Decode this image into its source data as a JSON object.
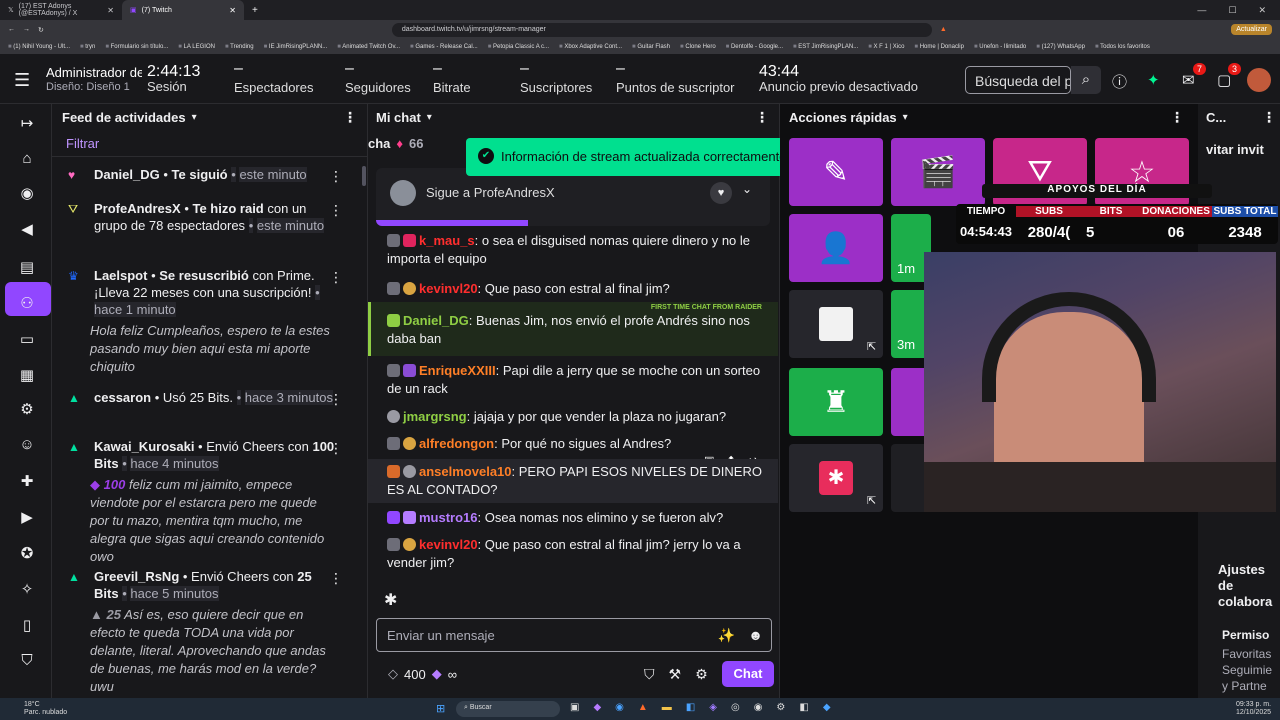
{
  "browser": {
    "tabs": [
      {
        "label": "(17) EST Adonys (@ESTAdonys) / X"
      },
      {
        "label": "(7) Twitch"
      }
    ],
    "url": "dashboard.twitch.tv/u/jimrsng/stream-manager",
    "update_label": "Actualizar",
    "bookmarks": [
      "(1) Nihil Young - Ult...",
      "tryn",
      "Formulario sin título...",
      "LA LEGION",
      "Trending",
      "IE JimRisingPLANN...",
      "Animated Twitch Ov...",
      "Games - Release Cal...",
      "Petopia Classic A c...",
      "Xbox Adaptive Cont...",
      "Guitar Flash",
      "Clone Hero",
      "Dentolfe - Google...",
      "EST JimRisingPLAN...",
      "X F 1 | Xico",
      "Home | Donaclip",
      "Unefon - Ilimitado",
      "(127) WhatsApp",
      "Todos los favoritos"
    ]
  },
  "topbar": {
    "user_role": "Administrador de",
    "design": "Diseño: Diseño 1",
    "session_time": "2:44:13",
    "session_label": "Sesión",
    "viewers_value": "–",
    "viewers_label": "Espectadores",
    "followers_value": "–",
    "followers_label": "Seguidores",
    "bitrate_value": "–",
    "bitrate_label": "Bitrate",
    "subs_value": "–",
    "subs_label": "Suscriptores",
    "sub_points_value": "–",
    "sub_points_label": "Puntos de suscriptor",
    "ad_time": "43:44",
    "ad_label": "Anuncio previo desactivado",
    "search_placeholder": "Búsqueda del p",
    "inbox_badge": "7",
    "notif_badge": "3"
  },
  "feed": {
    "title": "Feed de actividades",
    "filter": "Filtrar",
    "events": [
      {
        "user": "Daniel_DG",
        "action": "Te siguió",
        "time": "este minuto"
      },
      {
        "user": "ProfeAndresX",
        "action": "Te hizo raid",
        "detail": "con un grupo de 78 espectadores",
        "time": "este minuto"
      },
      {
        "user": "Laelspot",
        "action": "Se resuscribió",
        "detail": "con Prime.",
        "extra": "¡Lleva 22 meses con una suscripción!",
        "time": "hace 1 minuto",
        "message": "Hola feliz Cumpleaños, espero te la estes pasando muy bien aqui esta mi aporte chiquito"
      },
      {
        "user": "cessaron",
        "action": "Usó 25 Bits.",
        "time": "hace 3 minutos"
      },
      {
        "user": "Kawai_Kurosaki",
        "action": "Envió Cheers con",
        "bits": "100 Bits",
        "time": "hace 4 minutos",
        "message_bits": "100",
        "message": "feliz cum mi jaimito, empece viendote por el estarcra pero me quede por tu mazo, mentira tqm mucho, me alegra que sigas aqui creando contenido owo"
      },
      {
        "user": "Greevil_RsNg",
        "action": "Envió Cheers con",
        "bits": "25 Bits",
        "time": "hace 5 minutos",
        "message_bits": "25",
        "message": "Así es, eso quiere decir que en efecto te queda TODA una vida por delante, literal. Aprovechando que andas de buenas, me harás mod en la verde? uwu"
      }
    ]
  },
  "chat": {
    "title": "Mi chat",
    "pinned_partial": "cha",
    "pinned_count": "66",
    "follow_banner": "Sigue a ProfeAndresX",
    "raider_label": "FIRST TIME CHAT FROM RAIDER",
    "messages": [
      {
        "user": "k_mau_s",
        "text": "o sea el disguised nomas quiere dinero y no le importa el equipo",
        "color": "#ff2e2e"
      },
      {
        "user": "kevinvl20",
        "text": "Que paso con estral al final jim?",
        "color": "#ff2e2e"
      },
      {
        "user": "Daniel_DG",
        "text": "Buenas Jim, nos envió el profe Andrés sino nos daba ban",
        "color": "#8fce44"
      },
      {
        "user": "EnriqueXXIII",
        "text": "Papi dile a jerry que se moche con un sorteo de un rack",
        "color": "#ff7f27"
      },
      {
        "user": "jmargrsng",
        "text": "jajaja y por que vender la plaza no jugaran?",
        "color": "#8fce44"
      },
      {
        "user": "alfredongon",
        "text": "Por qué no sigues al Andres?",
        "color": "#ff7f27"
      },
      {
        "user": "anselmovela10",
        "text": "PERO PAPI ESOS NIVELES DE DINERO ES AL CONTADO?",
        "color": "#ff7f27"
      },
      {
        "user": "mustro16",
        "text": "Osea nomas nos elimino y se fueron alv?",
        "color": "#b57cff"
      },
      {
        "user": "kevinvl20",
        "text": "Que paso con estral al final jim? jerry lo va a vender jim?",
        "color": "#ff2e2e"
      }
    ],
    "input_placeholder": "Enviar un mensaje",
    "points": "400",
    "infinity": "∞",
    "send_label": "Chat"
  },
  "toast": {
    "text": "Información de stream actualizada correctamente."
  },
  "quick_actions": {
    "title": "Acciones rápidas",
    "timer_1": "1m",
    "timer_2": "3m"
  },
  "right_col": {
    "title_partial": "C...",
    "invite_partial": "vitar invit",
    "settings_partial_1": "Ajustes",
    "settings_partial_2": "de",
    "settings_partial_3": "colabora",
    "perm_partial": "Permiso",
    "perm_items": [
      "Favoritas",
      "Seguimie",
      "y Partne"
    ]
  },
  "overlay": {
    "header": "APOYOS DEL DÍA",
    "cols": [
      "TIEMPO",
      "SUBS",
      "BITS",
      "DONACIONES",
      "SUBS TOTAL"
    ],
    "values": [
      "04:54:43",
      "280/4(",
      "5",
      "06",
      "2348"
    ]
  },
  "taskbar": {
    "search": "Buscar",
    "weather_temp": "18°C",
    "weather_desc": "Parc. nublado",
    "time": "09:33 p. m.",
    "date": "12/10/2025"
  },
  "colors": {
    "accent": "#9147ff",
    "success": "#00e08f",
    "bg": "#0e0e10",
    "panel": "#18181b"
  }
}
